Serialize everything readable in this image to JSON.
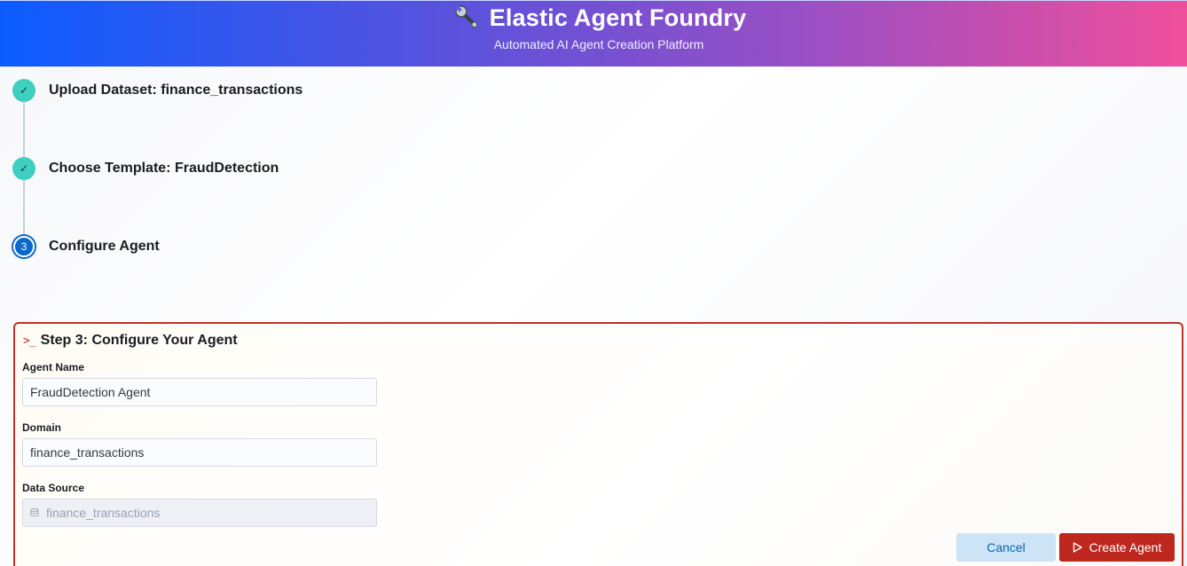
{
  "header": {
    "title": "Elastic Agent Foundry",
    "subtitle": "Automated AI Agent Creation Platform",
    "icon": "wrench-icon"
  },
  "steps": [
    {
      "label": "Upload Dataset: finance_transactions",
      "status": "complete",
      "marker": "✓"
    },
    {
      "label": "Choose Template: FraudDetection",
      "status": "complete",
      "marker": "✓"
    },
    {
      "label": "Configure Agent",
      "status": "current",
      "marker": "3"
    }
  ],
  "config": {
    "title": "Step 3: Configure Your Agent",
    "prompt_icon": ">_",
    "fields": {
      "agent_name": {
        "label": "Agent Name",
        "value": "FraudDetection Agent"
      },
      "domain": {
        "label": "Domain",
        "value": "finance_transactions"
      },
      "data_source": {
        "label": "Data Source",
        "value": "finance_transactions",
        "disabled": true
      }
    },
    "buttons": {
      "cancel": "Cancel",
      "create": "Create Agent"
    }
  },
  "colors": {
    "accent_blue": "#0b69c7",
    "complete_teal": "#3fcfc0",
    "danger_red": "#bd271e",
    "header_gradient_start": "#0b5cff",
    "header_gradient_end": "#ef4f9a"
  }
}
